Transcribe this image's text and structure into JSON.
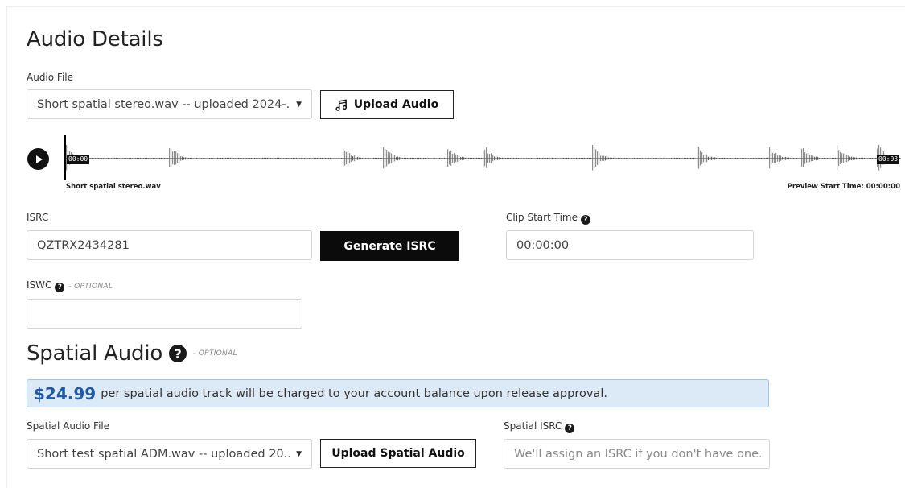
{
  "audio_details": {
    "heading": "Audio Details",
    "audio_file_label": "Audio File",
    "audio_file_selected": "Short spatial stereo.wav -- uploaded 2024-...",
    "upload_audio_label": "Upload Audio",
    "upload_audio_icon": "music-note-icon",
    "player": {
      "play_icon": "play-icon",
      "start_time": "00:00",
      "end_time": "00:03",
      "file_name": "Short spatial stereo.wav",
      "preview_start": "Preview Start Time: 00:00:00"
    },
    "isrc_label": "ISRC",
    "isrc_value": "QZTRX2434281",
    "generate_isrc_label": "Generate ISRC",
    "clip_start_label": "Clip Start Time",
    "clip_start_value": "00:00:00",
    "iswc_label": "ISWC",
    "iswc_optional": "- OPTIONAL",
    "iswc_value": ""
  },
  "spatial_audio": {
    "heading": "Spatial Audio",
    "optional": "- OPTIONAL",
    "notice_price": "$24.99",
    "notice_text": "per spatial audio track will be charged to your account balance upon release approval.",
    "file_label": "Spatial Audio File",
    "file_selected": "Short test spatial ADM.wav -- uploaded 20...",
    "upload_label": "Upload Spatial Audio",
    "spatial_isrc_label": "Spatial ISRC",
    "spatial_isrc_placeholder": "We'll assign an ISRC if you don't have one."
  },
  "colors": {
    "notice_bg": "#dce9f7",
    "notice_border": "#9ec3e6",
    "price": "#1e5aa8",
    "dark_button": "#0b0b0b"
  }
}
